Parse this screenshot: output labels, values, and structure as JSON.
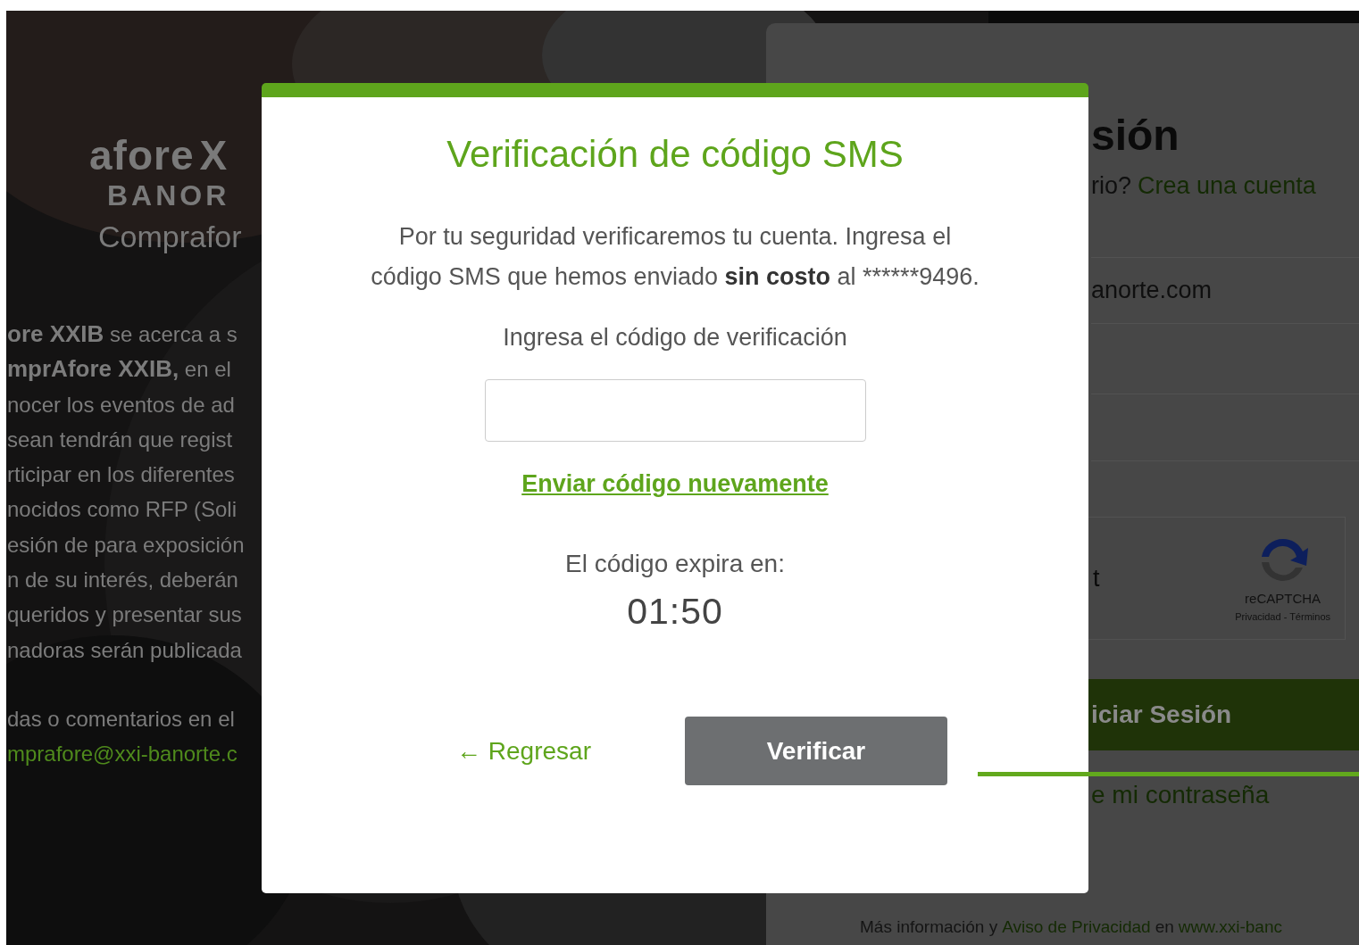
{
  "background": {
    "logo": {
      "brand": "afore",
      "mark": "X",
      "bank": "BANOR",
      "subtitle": "Comprafor"
    },
    "intro_lines": [
      "**ore XXIB** se acerca a s",
      "**mprAfore XXIB,** en el",
      "nocer los eventos de ad",
      "sean tendrán que regist",
      "rticipar en los diferentes",
      "nocidos como RFP (Soli",
      "esión de para exposición",
      "n de su interés, deberán",
      "queridos y presentar sus",
      "nadoras serán publicada"
    ],
    "contact_line": "das o comentarios en el",
    "contact_email": "mprafore@xxi-banorte.c"
  },
  "login_card": {
    "title": "sión",
    "signup_prompt": "rio?",
    "signup_link": "Crea una cuenta",
    "email_value": "anorte.com",
    "captcha": {
      "label": "t",
      "brand": "reCAPTCHA",
      "links": "Privacidad - Términos"
    },
    "submit": "iciar Sesión",
    "forgot_link": "e mi contraseña",
    "footer": {
      "text": "Más información y",
      "link": "Aviso de Privacidad",
      "middle": "en",
      "url": "www.xxi-banc"
    }
  },
  "modal": {
    "title": "Verificación de código SMS",
    "message": "Por tu seguridad verificaremos tu cuenta. Ingresa el código SMS que hemos enviado **sin costo** al",
    "masked_phone": "******9496.",
    "code_label": "Ingresa el código de verificación",
    "resend_link": "Enviar código nuevamente",
    "expires_label": "El código expira en:",
    "countdown": "01:50",
    "back_link": "← Regresar",
    "verify_button": "Verificar"
  }
}
